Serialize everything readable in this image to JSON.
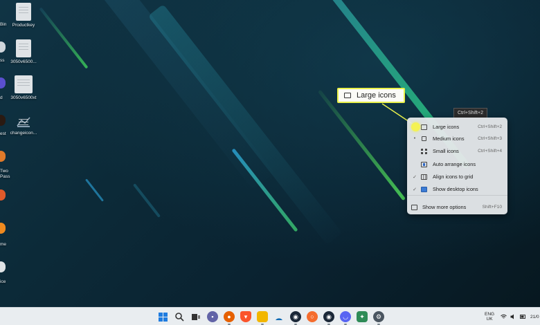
{
  "desktop": {
    "icons_column2": [
      {
        "label": "Productkey",
        "icon": "text-file-icon"
      },
      {
        "label": "3050v6500...",
        "icon": "text-file-icon"
      },
      {
        "label": "3050v6500xt",
        "icon": "document-icon"
      },
      {
        "label": "changeicon...",
        "icon": "shortcut-icon"
      }
    ],
    "edge_labels": [
      "Bin",
      "ss",
      "d",
      "est",
      "Two\nPass",
      "me",
      "ice"
    ]
  },
  "callout": {
    "label": "Large icons",
    "highlight_color": "#e9f14a"
  },
  "tooltip": {
    "text": "Ctrl+Shift+2"
  },
  "view_menu": {
    "items": [
      {
        "label": "Large icons",
        "shortcut": "Ctrl+Shift+2",
        "check": "",
        "icon": "large-icons-icon"
      },
      {
        "label": "Medium icons",
        "shortcut": "Ctrl+Shift+3",
        "check": "•",
        "icon": "medium-icons-icon"
      },
      {
        "label": "Small icons",
        "shortcut": "Ctrl+Shift+4",
        "check": "",
        "icon": "small-icons-icon"
      },
      {
        "label": "Auto arrange icons",
        "shortcut": "",
        "check": "",
        "icon": "auto-arrange-icon"
      },
      {
        "label": "Align icons to grid",
        "shortcut": "",
        "check": "✓",
        "icon": "align-grid-icon"
      },
      {
        "label": "Show desktop icons",
        "shortcut": "",
        "check": "✓",
        "icon": "show-desktop-icon"
      }
    ],
    "more": {
      "label": "Show more options",
      "shortcut": "Shift+F10",
      "icon": "more-options-icon"
    }
  },
  "taskbar": {
    "apps": [
      {
        "name": "start",
        "icon": "windows-logo-icon",
        "color": "#1f7ce0"
      },
      {
        "name": "search",
        "icon": "search-icon",
        "color": "#333333"
      },
      {
        "name": "task-view",
        "icon": "task-view-icon",
        "color": "#333333"
      },
      {
        "name": "chat",
        "icon": "chat-icon",
        "color": "#6264a7"
      },
      {
        "name": "firefox",
        "icon": "firefox-icon",
        "color": "#e66000"
      },
      {
        "name": "brave",
        "icon": "brave-icon",
        "color": "#fb542b"
      },
      {
        "name": "explorer",
        "icon": "folder-icon",
        "color": "#f2b600"
      },
      {
        "name": "app-blue",
        "icon": "app-icon",
        "color": "#0f6ab4"
      },
      {
        "name": "steam",
        "icon": "steam-icon",
        "color": "#1b2838"
      },
      {
        "name": "origin",
        "icon": "origin-icon",
        "color": "#f56c2d"
      },
      {
        "name": "steam-2",
        "icon": "steam-icon",
        "color": "#1b2838"
      },
      {
        "name": "discord",
        "icon": "discord-icon",
        "color": "#5865f2"
      },
      {
        "name": "app-green",
        "icon": "app-icon",
        "color": "#2e8b57"
      },
      {
        "name": "settings",
        "icon": "gear-icon",
        "color": "#4a5560"
      }
    ],
    "tray": {
      "lang_top": "ENG",
      "lang_bottom": "UK",
      "clock": "21/0"
    }
  }
}
